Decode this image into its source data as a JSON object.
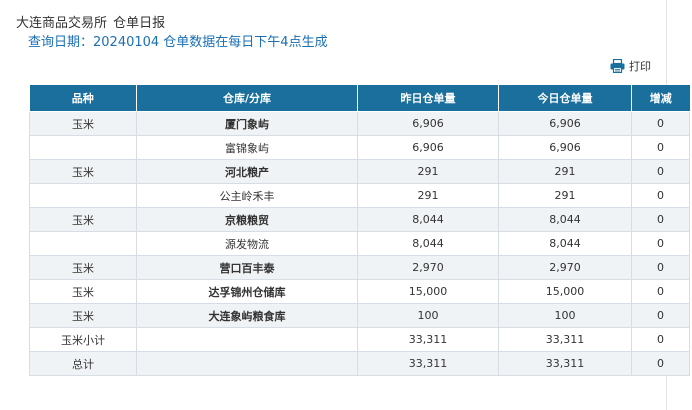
{
  "header": {
    "exchange": "大连商品交易所",
    "report": "仓单日报"
  },
  "query_line": "查询日期：20240104 仓单数据在每日下午4点生成",
  "print_label": "打印",
  "table": {
    "columns": [
      "品种",
      "仓库/分库",
      "昨日仓单量",
      "今日仓单量",
      "增减"
    ],
    "rows": [
      {
        "variety": "玉米",
        "warehouse": "厦门象屿",
        "yesterday": "6,906",
        "today": "6,906",
        "change": "0",
        "bold": true
      },
      {
        "variety": "",
        "warehouse": "富锦象屿",
        "yesterday": "6,906",
        "today": "6,906",
        "change": "0",
        "bold": false
      },
      {
        "variety": "玉米",
        "warehouse": "河北粮产",
        "yesterday": "291",
        "today": "291",
        "change": "0",
        "bold": true
      },
      {
        "variety": "",
        "warehouse": "公主岭禾丰",
        "yesterday": "291",
        "today": "291",
        "change": "0",
        "bold": false
      },
      {
        "variety": "玉米",
        "warehouse": "京粮粮贸",
        "yesterday": "8,044",
        "today": "8,044",
        "change": "0",
        "bold": true
      },
      {
        "variety": "",
        "warehouse": "源发物流",
        "yesterday": "8,044",
        "today": "8,044",
        "change": "0",
        "bold": false
      },
      {
        "variety": "玉米",
        "warehouse": "营口百丰泰",
        "yesterday": "2,970",
        "today": "2,970",
        "change": "0",
        "bold": true
      },
      {
        "variety": "玉米",
        "warehouse": "达孚锦州仓储库",
        "yesterday": "15,000",
        "today": "15,000",
        "change": "0",
        "bold": true
      },
      {
        "variety": "玉米",
        "warehouse": "大连象屿粮食库",
        "yesterday": "100",
        "today": "100",
        "change": "0",
        "bold": true
      },
      {
        "variety": "玉米小计",
        "warehouse": "",
        "yesterday": "33,311",
        "today": "33,311",
        "change": "0",
        "bold": false
      },
      {
        "variety": "总计",
        "warehouse": "",
        "yesterday": "33,311",
        "today": "33,311",
        "change": "0",
        "bold": false
      }
    ]
  },
  "colors": {
    "header_bg": "#1a6f9c",
    "query_text": "#1a6fb5",
    "row_alt_bg": "#f0f3f6",
    "border": "#d6dde4"
  }
}
